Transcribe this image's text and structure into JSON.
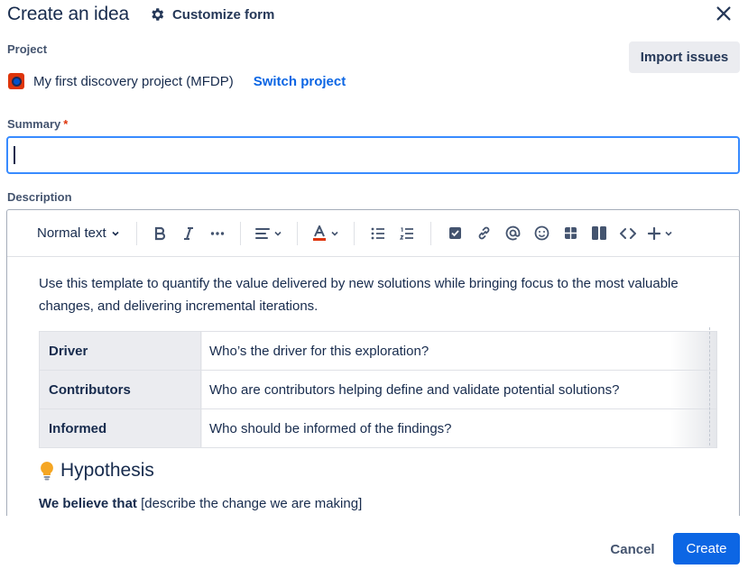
{
  "header": {
    "title": "Create an idea",
    "customize_label": "Customize form",
    "icons": {
      "customize": "gear-icon",
      "close": "close-icon"
    }
  },
  "project": {
    "label": "Project",
    "name": "My first discovery project (MFDP)",
    "switch_label": "Switch project",
    "import_label": "Import issues",
    "avatar_colors": {
      "background": "#de350b",
      "inner": "#0052cc"
    }
  },
  "summary": {
    "label": "Summary",
    "required_marker": "*",
    "value": ""
  },
  "description": {
    "label": "Description",
    "toolbar": {
      "text_style": "Normal text",
      "items": [
        "bold-icon",
        "italic-icon",
        "more-formatting-icon",
        "align-icon",
        "text-color-icon",
        "bullet-list-icon",
        "numbered-list-icon",
        "action-item-icon",
        "link-icon",
        "mention-icon",
        "emoji-icon",
        "table-icon",
        "layout-icon",
        "code-icon",
        "insert-icon"
      ]
    },
    "intro": "Use this template to quantify the value delivered by new solutions while bringing focus to the most valuable changes, and delivering incremental iterations.",
    "table": [
      {
        "key": "Driver",
        "value": "Who’s the driver for this exploration?"
      },
      {
        "key": "Contributors",
        "value": "Who are contributors helping define and validate potential solutions?"
      },
      {
        "key": "Informed",
        "value": "Who should be informed of the findings?"
      }
    ],
    "heading": "Hypothesis",
    "heading_icon": "lightbulb-icon",
    "believe_bold": "We believe that",
    "believe_rest": " [describe the change we are making]"
  },
  "footer": {
    "cancel_label": "Cancel",
    "create_label": "Create"
  },
  "colors": {
    "accent": "#0c66e4",
    "focus_border": "#388bff",
    "required": "#de350b"
  }
}
